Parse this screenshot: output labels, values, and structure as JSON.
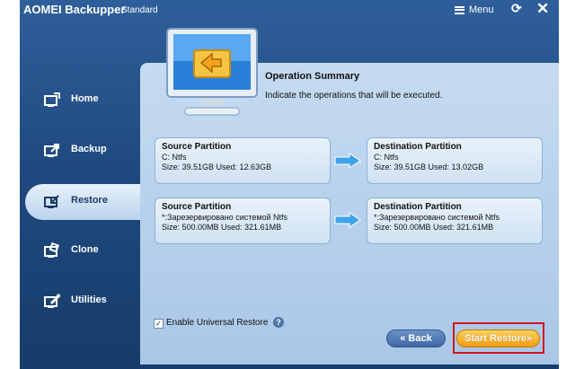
{
  "app": {
    "title": "AOMEI Backupper",
    "edition": "Standard"
  },
  "titlebar": {
    "menu_label": "Menu",
    "refresh_glyph": "⟳",
    "close_glyph": "✕"
  },
  "sidebar": {
    "items": [
      {
        "label": "Home",
        "icon": "home-icon"
      },
      {
        "label": "Backup",
        "icon": "backup-icon"
      },
      {
        "label": "Restore",
        "icon": "restore-icon",
        "active": true
      },
      {
        "label": "Clone",
        "icon": "clone-icon"
      },
      {
        "label": "Utilities",
        "icon": "utilities-icon"
      }
    ]
  },
  "summary": {
    "title": "Operation Summary",
    "subtitle": "Indicate the operations that will be executed."
  },
  "operations": [
    {
      "source": {
        "title": "Source Partition",
        "name": "C: Ntfs",
        "size": "Size: 39.51GB  Used: 12.63GB"
      },
      "destination": {
        "title": "Destination Partition",
        "name": "C: Ntfs",
        "size": "Size: 39.51GB  Used: 13.02GB"
      }
    },
    {
      "source": {
        "title": "Source Partition",
        "name": "*:Зарезервировано системой Ntfs",
        "size": "Size: 500.00MB  Used: 321.61MB"
      },
      "destination": {
        "title": "Destination Partition",
        "name": "*:Зарезервировано системой Ntfs",
        "size": "Size: 500.00MB  Used: 321.61MB"
      }
    }
  ],
  "options": {
    "universal_restore_label": "Enable Universal Restore",
    "universal_restore_checked": true,
    "help_glyph": "?"
  },
  "buttons": {
    "back_label": "« Back",
    "start_label": "Start Restore»"
  },
  "colors": {
    "accent": "#f29d12",
    "highlight_frame": "#d0151c",
    "window_bg": "#1f4a80"
  }
}
